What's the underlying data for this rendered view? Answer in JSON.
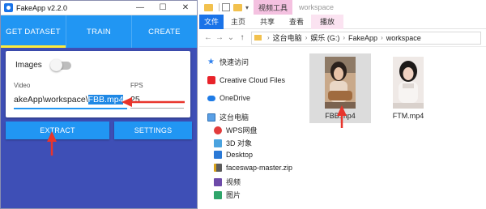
{
  "app": {
    "title": "FakeApp v2.2.0",
    "window_controls": {
      "minimize": "—",
      "maximize": "☐",
      "close": "✕"
    },
    "tabs": [
      {
        "label": "GET DATASET",
        "active": true
      },
      {
        "label": "TRAIN",
        "active": false
      },
      {
        "label": "CREATE",
        "active": false
      }
    ],
    "images_label": "Images",
    "images_toggle_on": false,
    "video_label": "Video",
    "video_path_prefix": "akeApp\\workspace\\",
    "video_path_selected": "FBB.mp4",
    "fps_label": "FPS",
    "fps_value": "25",
    "extract_button": "EXTRACT",
    "settings_button": "SETTINGS",
    "colors": {
      "primary": "#2196f3",
      "background": "#3e4fb6",
      "annotation_arrow": "#e8352c"
    }
  },
  "explorer": {
    "context_tab": "视频工具",
    "window_title": "workspace",
    "ribbon": {
      "file": "文件",
      "home": "主页",
      "share": "共享",
      "view": "查看",
      "manage": "播放"
    },
    "address": {
      "root": "这台电脑",
      "drive": "娱乐 (G:)",
      "folder1": "FakeApp",
      "folder2": "workspace"
    },
    "nav": {
      "quick_access": "快速访问",
      "creative_cloud": "Creative Cloud Files",
      "onedrive": "OneDrive",
      "this_pc": "这台电脑",
      "wps": "WPS网盘",
      "objects3d": "3D 对象",
      "desktop": "Desktop",
      "zip": "faceswap-master.zip",
      "videos": "视频",
      "pictures": "图片"
    },
    "files": [
      {
        "name": "FBB.mp4",
        "selected": true
      },
      {
        "name": "FTM.mp4",
        "selected": false
      }
    ]
  }
}
